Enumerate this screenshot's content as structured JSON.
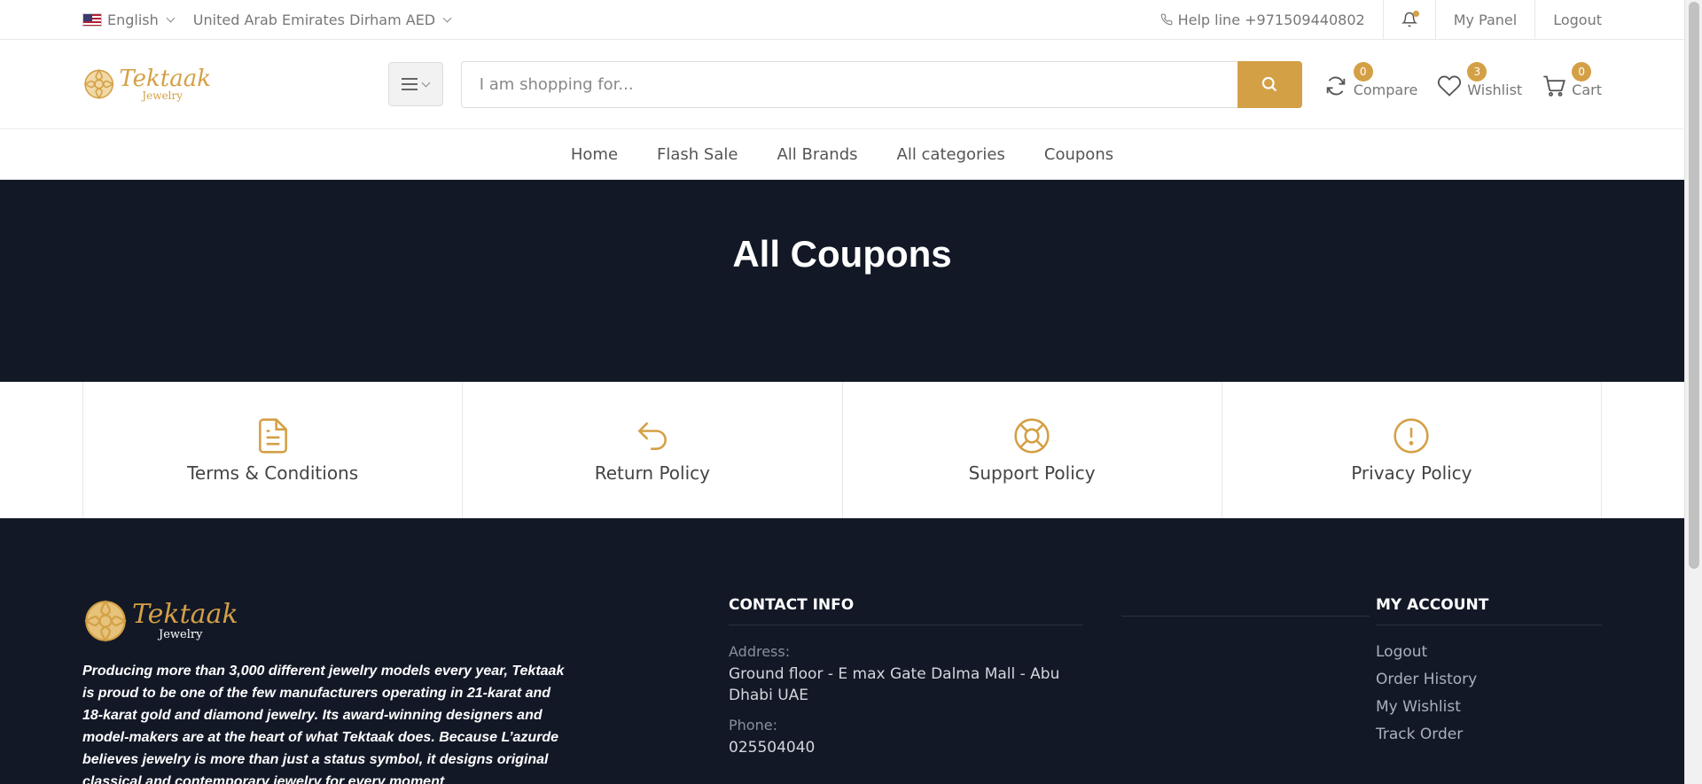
{
  "topbar": {
    "language": "English",
    "currency": "United Arab Emirates Dirham AED",
    "helpline": "Help line +971509440802",
    "my_panel": "My Panel",
    "logout": "Logout"
  },
  "header": {
    "logo_text": "Tektaak",
    "logo_sub": "Jewelry",
    "search_placeholder": "I am shopping for...",
    "compare": {
      "label": "Compare",
      "count": "0"
    },
    "wishlist": {
      "label": "Wishlist",
      "count": "3"
    },
    "cart": {
      "label": "Cart",
      "count": "0"
    }
  },
  "nav": {
    "items": [
      "Home",
      "Flash Sale",
      "All Brands",
      "All categories",
      "Coupons"
    ]
  },
  "hero": {
    "title": "All Coupons"
  },
  "policies": {
    "items": [
      "Terms & Conditions",
      "Return Policy",
      "Support Policy",
      "Privacy Policy"
    ]
  },
  "footer": {
    "logo_text": "Tektaak",
    "logo_sub": "Jewelry",
    "about": "Producing more than 3,000 different jewelry models every year, Tektaak is proud to be one of the few manufacturers operating in 21-karat and 18-karat gold and diamond jewelry. Its award-winning designers and model-makers are at the heart of what Tektaak does. Because L’azurde believes jewelry is more than just a status symbol, it designs original classical and contemporary jewelry for every moment",
    "contact": {
      "title": "CONTACT INFO",
      "address_label": "Address:",
      "address": "Ground floor - E max Gate Dalma Mall - Abu Dhabi UAE",
      "phone_label": "Phone:",
      "phone": "025504040"
    },
    "account": {
      "title": "MY ACCOUNT",
      "links": [
        "Logout",
        "Order History",
        "My Wishlist",
        "Track Order"
      ]
    }
  },
  "colors": {
    "accent": "#d4a046",
    "dark": "#121826"
  }
}
